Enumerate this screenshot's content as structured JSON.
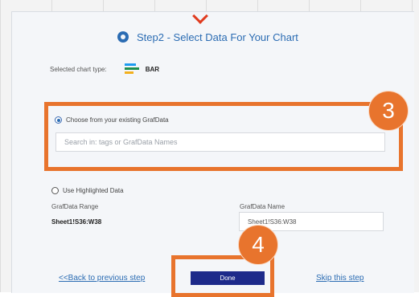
{
  "dialog": {
    "title": "Step2 - Select Data For Your Chart",
    "chart_type_label": "Selected chart type:",
    "chart_type_value": "BAR",
    "existing_option_label": "Choose from your existing GrafData",
    "search_placeholder": "Search in: tags or GrafData Names",
    "highlighted_option_label": "Use Highlighted Data",
    "range_label": "GrafData Range",
    "range_value": "Sheet1!S36:W38",
    "name_label": "GrafData Name",
    "name_value": "Sheet1!S36:W38",
    "back_link": "<<Back to previous step",
    "done_button": "Done",
    "skip_link": "Skip this step"
  },
  "annotations": {
    "step3": "3",
    "step4": "4"
  },
  "colors": {
    "accent": "#2b6cb3",
    "done_button": "#1d2a8a",
    "callout": "#e8742d",
    "arrow": "#e03b1f",
    "bar_icon": [
      "#1d9bf0",
      "#1f8f4e",
      "#f2b01e",
      "#1f8f4e"
    ]
  },
  "icons": {
    "logo": "grafdata-logo-icon",
    "chart_type": "bar-chart-icon"
  }
}
